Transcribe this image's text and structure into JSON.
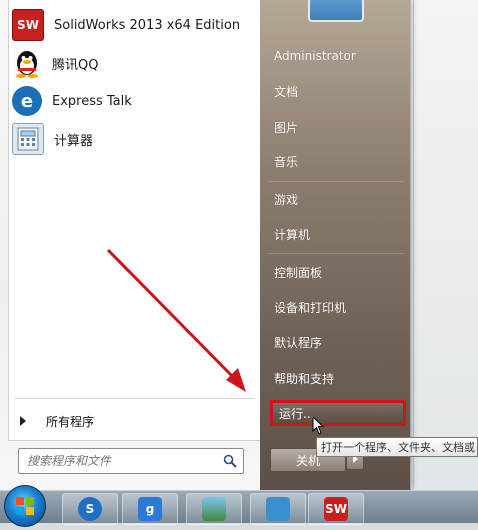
{
  "programs": [
    {
      "label": "SolidWorks 2013 x64 Edition",
      "icon": "solidworks-icon",
      "icon_text": "SW"
    },
    {
      "label": "腾讯QQ",
      "icon": "qq-penguin-icon"
    },
    {
      "label": "Express Talk",
      "icon": "express-talk-icon",
      "icon_text": "e"
    },
    {
      "label": "计算器",
      "icon": "calculator-icon"
    }
  ],
  "all_programs": {
    "label": "所有程序"
  },
  "search": {
    "placeholder": "搜索程序和文件"
  },
  "right_items": [
    {
      "label": "Administrator"
    },
    {
      "label": "文档"
    },
    {
      "label": "图片"
    },
    {
      "label": "音乐"
    },
    {
      "label": "游戏"
    },
    {
      "label": "计算机"
    },
    {
      "label": "控制面板"
    },
    {
      "label": "设备和打印机"
    },
    {
      "label": "默认程序"
    },
    {
      "label": "帮助和支持"
    }
  ],
  "run": {
    "label": "运行..."
  },
  "shutdown": {
    "label": "关机"
  },
  "tooltip": {
    "text": "打开一个程序、文件夹、文档或"
  },
  "colors": {
    "highlight": "#d0121a",
    "annotation_arrow": "#d0121a"
  },
  "taskbar": {
    "items": [
      {
        "icon": "start-orb-icon"
      },
      {
        "icon": "sogou-icon",
        "icon_text": "S"
      },
      {
        "icon": "browser-icon",
        "icon_text": "g"
      },
      {
        "icon": "image-viewer-icon"
      },
      {
        "icon": "control-panel-icon"
      },
      {
        "icon": "solidworks-icon",
        "icon_text": "SW"
      }
    ]
  }
}
